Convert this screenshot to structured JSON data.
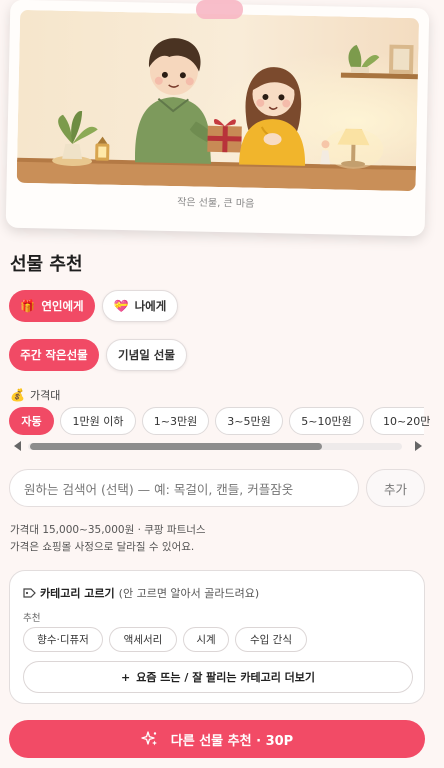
{
  "hero": {
    "caption": "작은 선물, 큰 마음"
  },
  "title": "선물 추천",
  "recipients": [
    {
      "label": "연인에게",
      "icon": "gift-icon",
      "active": true
    },
    {
      "label": "나에게",
      "icon": "heart-gift-icon",
      "active": false
    }
  ],
  "modes": [
    {
      "label": "주간 작은선물",
      "active": true
    },
    {
      "label": "기념일 선물",
      "active": false
    }
  ],
  "price": {
    "label": "가격대",
    "icon": "money-bag-icon",
    "options": [
      {
        "label": "자동",
        "active": true
      },
      {
        "label": "1만원 이하",
        "active": false
      },
      {
        "label": "1~3만원",
        "active": false
      },
      {
        "label": "3~5만원",
        "active": false
      },
      {
        "label": "5~10만원",
        "active": false
      },
      {
        "label": "10~20만",
        "active": false
      }
    ]
  },
  "search": {
    "placeholder": "원하는 검색어 (선택) — 예: 목걸이, 캔들, 커플잠옷",
    "add_label": "추가"
  },
  "info": {
    "line1": "가격대 15,000~35,000원 · 쿠팡 파트너스",
    "line2": "가격은 쇼핑몰 사정으로 달라질 수 있어요."
  },
  "category": {
    "title": "카테고리 고르기",
    "subtitle": "(안 고르면 알아서 골라드려요)",
    "icon": "tag-icon",
    "rec_label": "추천",
    "chips": [
      "향수·디퓨저",
      "액세서리",
      "시계",
      "수입 간식"
    ],
    "more_label": "요즘 뜨는 / 잘 팔리는 카테고리 더보기",
    "more_icon": "+"
  },
  "cta": {
    "label": "다른 선물 추천 · 30P",
    "icon": "sparkle-icon"
  },
  "colors": {
    "accent": "#f14a65",
    "background": "#fdf6f4"
  }
}
